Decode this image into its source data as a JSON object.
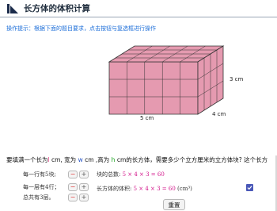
{
  "window": {
    "title": "长方体的体积计算"
  },
  "hint": {
    "text": "操作提示：根据下面的题目要求，点击按钮与复选框进行操作"
  },
  "figure": {
    "length_label": "5 cm",
    "width_label": "4 cm",
    "height_label": "3 cm",
    "cube_color": "#e59ab0",
    "grid": {
      "length": 5,
      "width": 4,
      "height": 3
    }
  },
  "question": {
    "part1": "要填满一个长为",
    "l": "l",
    "part2": " cm, 宽为 ",
    "w": "w",
    "part3": " cm ,高为 ",
    "h": "h",
    "part4": " cm的长方体，需要多少个立方厘米的立方体块? 这个长方"
  },
  "controls": {
    "per_row_label": "每一行有5块;",
    "per_layer_label": "每一层有4行；",
    "layers_label": "总共有3层。",
    "minus": "−",
    "plus": "+"
  },
  "results": {
    "count_prefix": "块的总数:",
    "count_expr": "5 × 4 × 3 = 60",
    "volume_prefix": "长方体的体积:",
    "volume_expr": "5 × 4 × 3 = 60",
    "volume_unit": "(cm³)"
  },
  "checkbox": {
    "checked": true
  },
  "reset_button": {
    "label": "重置"
  }
}
